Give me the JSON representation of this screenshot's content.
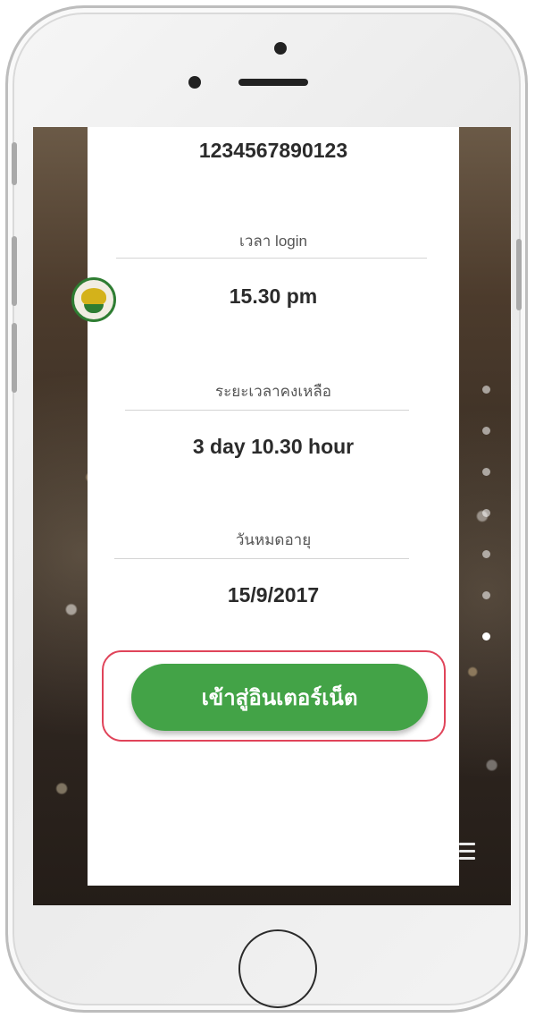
{
  "account": {
    "id": "1234567890123"
  },
  "info": {
    "login_label": "เวลา login",
    "login_value": "15.30 pm",
    "remaining_label": "ระยะเวลาคงเหลือ",
    "remaining_value": "3 day 10.30 hour",
    "expiry_label": "วันหมดอายุ",
    "expiry_value": "15/9/2017"
  },
  "actions": {
    "connect_label": "เข้าสู่อินเตอร์เน็ต"
  },
  "pager": {
    "total": 7,
    "active_index": 6
  },
  "colors": {
    "primary_button": "#43a347",
    "highlight_outline": "#e0445a"
  },
  "icons": {
    "logo": "emblem-logo",
    "menu": "hamburger-menu-icon"
  }
}
